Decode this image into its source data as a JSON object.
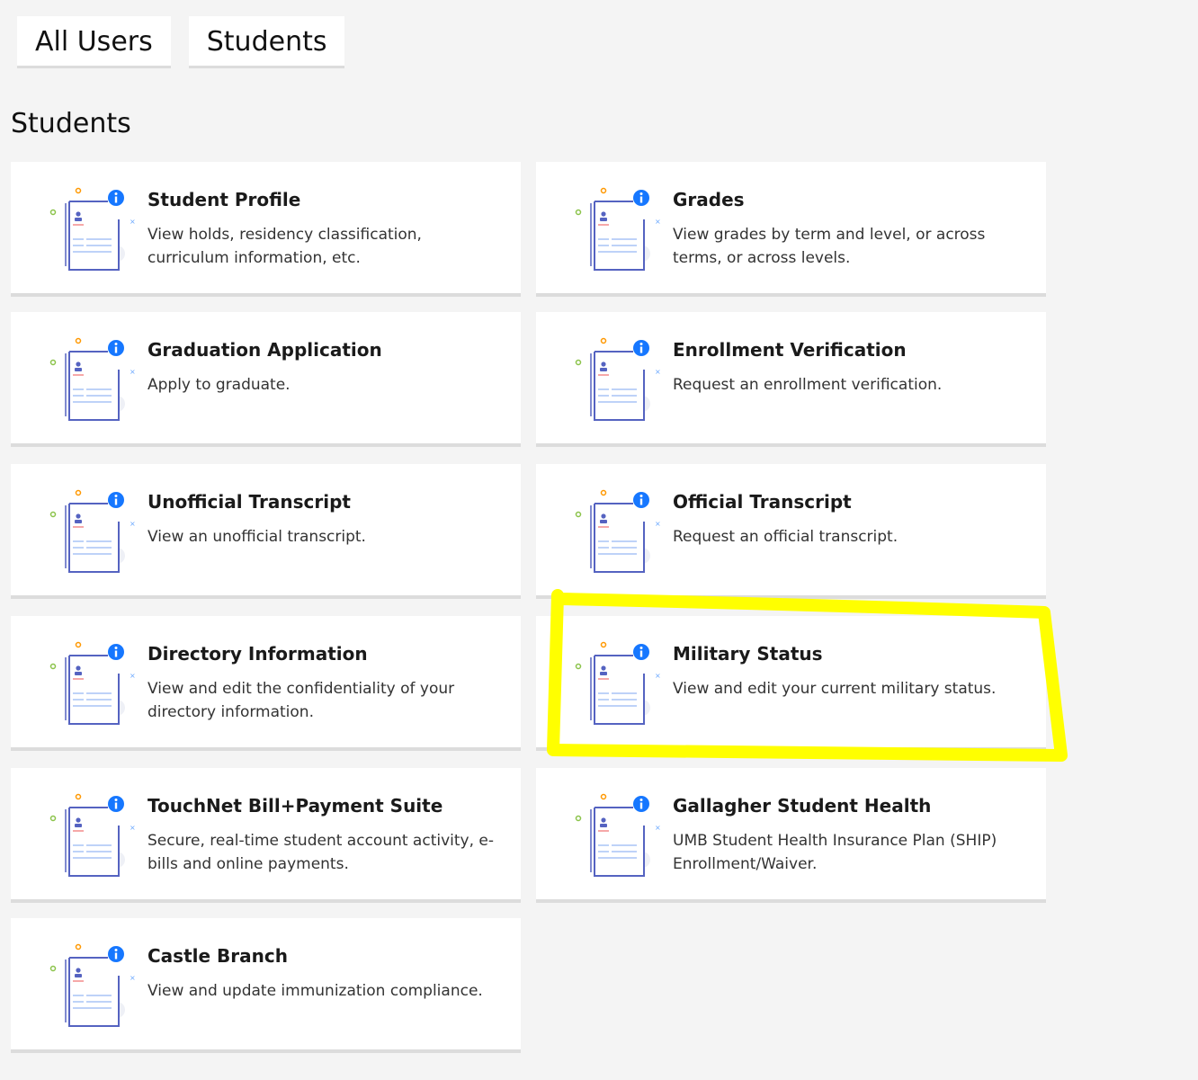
{
  "tabs": [
    {
      "label": "All Users"
    },
    {
      "label": "Students"
    }
  ],
  "section": {
    "title": "Students"
  },
  "cards": [
    {
      "title": "Student Profile",
      "description": "View holds, residency classification, curriculum information, etc.",
      "icon": "student-profile-icon"
    },
    {
      "title": "Grades",
      "description": "View grades by term and level, or across terms, or across levels.",
      "icon": "grades-icon"
    },
    {
      "title": "Graduation Application",
      "description": "Apply to graduate.",
      "icon": "graduation-application-icon"
    },
    {
      "title": "Enrollment Verification",
      "description": "Request an enrollment verification.",
      "icon": "enrollment-verification-icon"
    },
    {
      "title": "Unofficial Transcript",
      "description": "View an unofficial transcript.",
      "icon": "unofficial-transcript-icon"
    },
    {
      "title": "Official Transcript",
      "description": "Request an official transcript.",
      "icon": "official-transcript-icon"
    },
    {
      "title": "Directory Information",
      "description": "View and edit the confidentiality of your directory information.",
      "icon": "directory-information-icon"
    },
    {
      "title": "Military Status",
      "description": "View and edit your current military status.",
      "icon": "military-status-icon"
    },
    {
      "title": "TouchNet Bill+Payment Suite",
      "description": "Secure, real-time student account activity, e-bills and online payments.",
      "icon": "touchnet-icon"
    },
    {
      "title": "Gallagher Student Health",
      "description": "UMB Student Health Insurance Plan (SHIP) Enrollment/Waiver.",
      "icon": "student-health-icon"
    },
    {
      "title": "Castle Branch",
      "description": "View and update immunization compliance.",
      "icon": "castle-branch-icon"
    }
  ],
  "colors": {
    "page_background": "#f4f4f4",
    "card_background": "#ffffff",
    "icon_outline": "#5563c1",
    "icon_accent": "#1677ff",
    "highlight": "#ffff00"
  }
}
